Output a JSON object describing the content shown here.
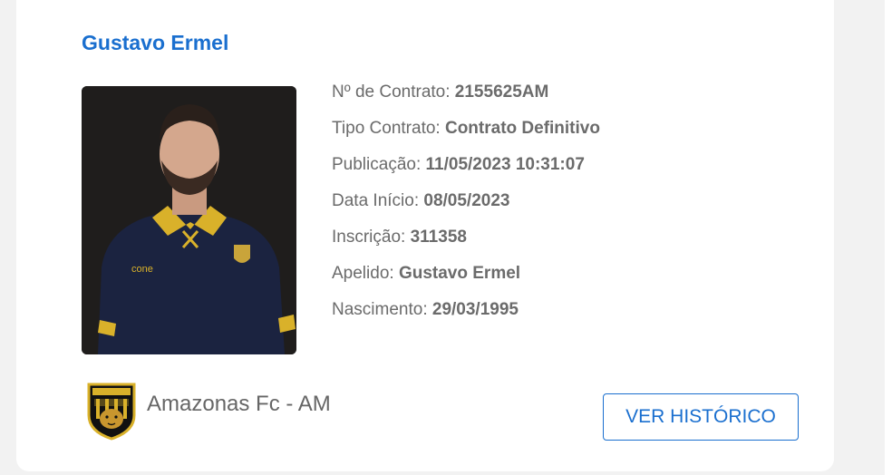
{
  "player": {
    "name": "Gustavo Ermel"
  },
  "details": [
    {
      "label": "Nº de Contrato: ",
      "value": "2155625AM"
    },
    {
      "label": "Tipo Contrato: ",
      "value": "Contrato Definitivo"
    },
    {
      "label": "Publicação: ",
      "value": "11/05/2023 10:31:07"
    },
    {
      "label": "Data Início: ",
      "value": "08/05/2023"
    },
    {
      "label": "Inscrição: ",
      "value": "311358"
    },
    {
      "label": "Apelido: ",
      "value": "Gustavo Ermel"
    },
    {
      "label": "Nascimento: ",
      "value": "29/03/1995"
    }
  ],
  "club": {
    "name": "Amazonas Fc - AM",
    "logo_icon": "club-crest-icon",
    "logo_text": "AMAZONAS FC"
  },
  "actions": {
    "history_label": "VER HISTÓRICO"
  },
  "colors": {
    "accent": "#1a6fcf",
    "text": "#6b6b6b",
    "card": "#ffffff",
    "background": "#f2f2f2"
  }
}
